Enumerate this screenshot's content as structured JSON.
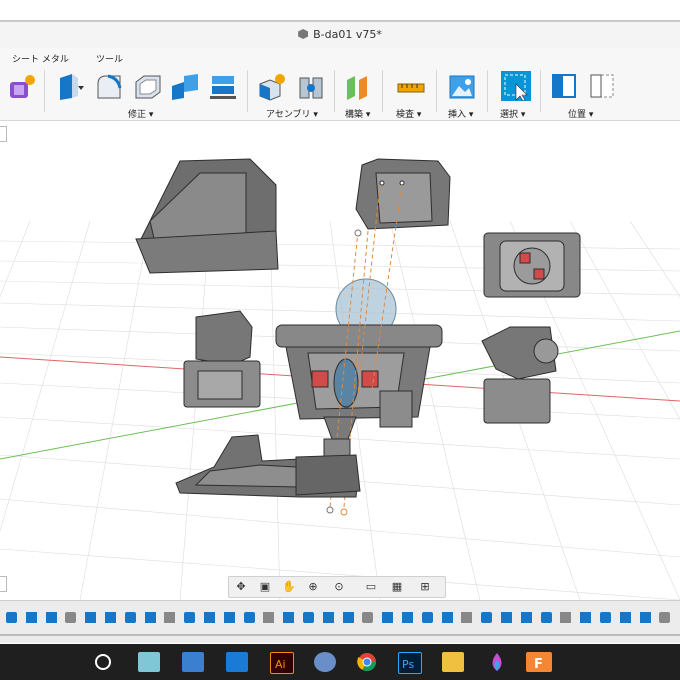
{
  "window": {
    "title": "B-da01 v75*"
  },
  "ribbon": {
    "sheet_metal_tab": "シート メタル",
    "tools_tab": "ツール",
    "groups": {
      "modify": "修正 ▾",
      "assemble": "アセンブリ ▾",
      "construct": "構築 ▾",
      "inspect": "検査 ▾",
      "insert": "挿入 ▾",
      "select": "選択 ▾",
      "position": "位置 ▾"
    },
    "icons": [
      "create-sheet-icon",
      "press-pull-icon",
      "fillet-icon",
      "shell-icon",
      "combine-icon",
      "align-icon",
      "new-component-icon",
      "joint-icon",
      "offset-plane-icon",
      "measure-icon",
      "insert-image-icon",
      "select-icon",
      "capture-position-icon",
      "revert-position-icon"
    ]
  },
  "navbar": {
    "icons": [
      "orbit-icon",
      "look-at-icon",
      "pan-icon",
      "zoom-window-icon",
      "fit-icon",
      "display-settings-icon",
      "grid-settings-icon",
      "viewports-icon"
    ]
  },
  "taskbar": {
    "icons": [
      "cortana-icon",
      "task-view-icon",
      "store-icon",
      "mail-icon",
      "illustrator-icon",
      "paint-icon",
      "chrome-icon",
      "photoshop-icon",
      "file-explorer-icon",
      "color-drop-icon",
      "fusion360-icon"
    ]
  },
  "colors": {
    "accent": "#0696d7",
    "part_gray": "#6e6e6e",
    "part_red": "#d24b4b",
    "axis_red": "#e06666",
    "axis_green": "#6bbf59",
    "taskbar": "#1f1f1f"
  }
}
